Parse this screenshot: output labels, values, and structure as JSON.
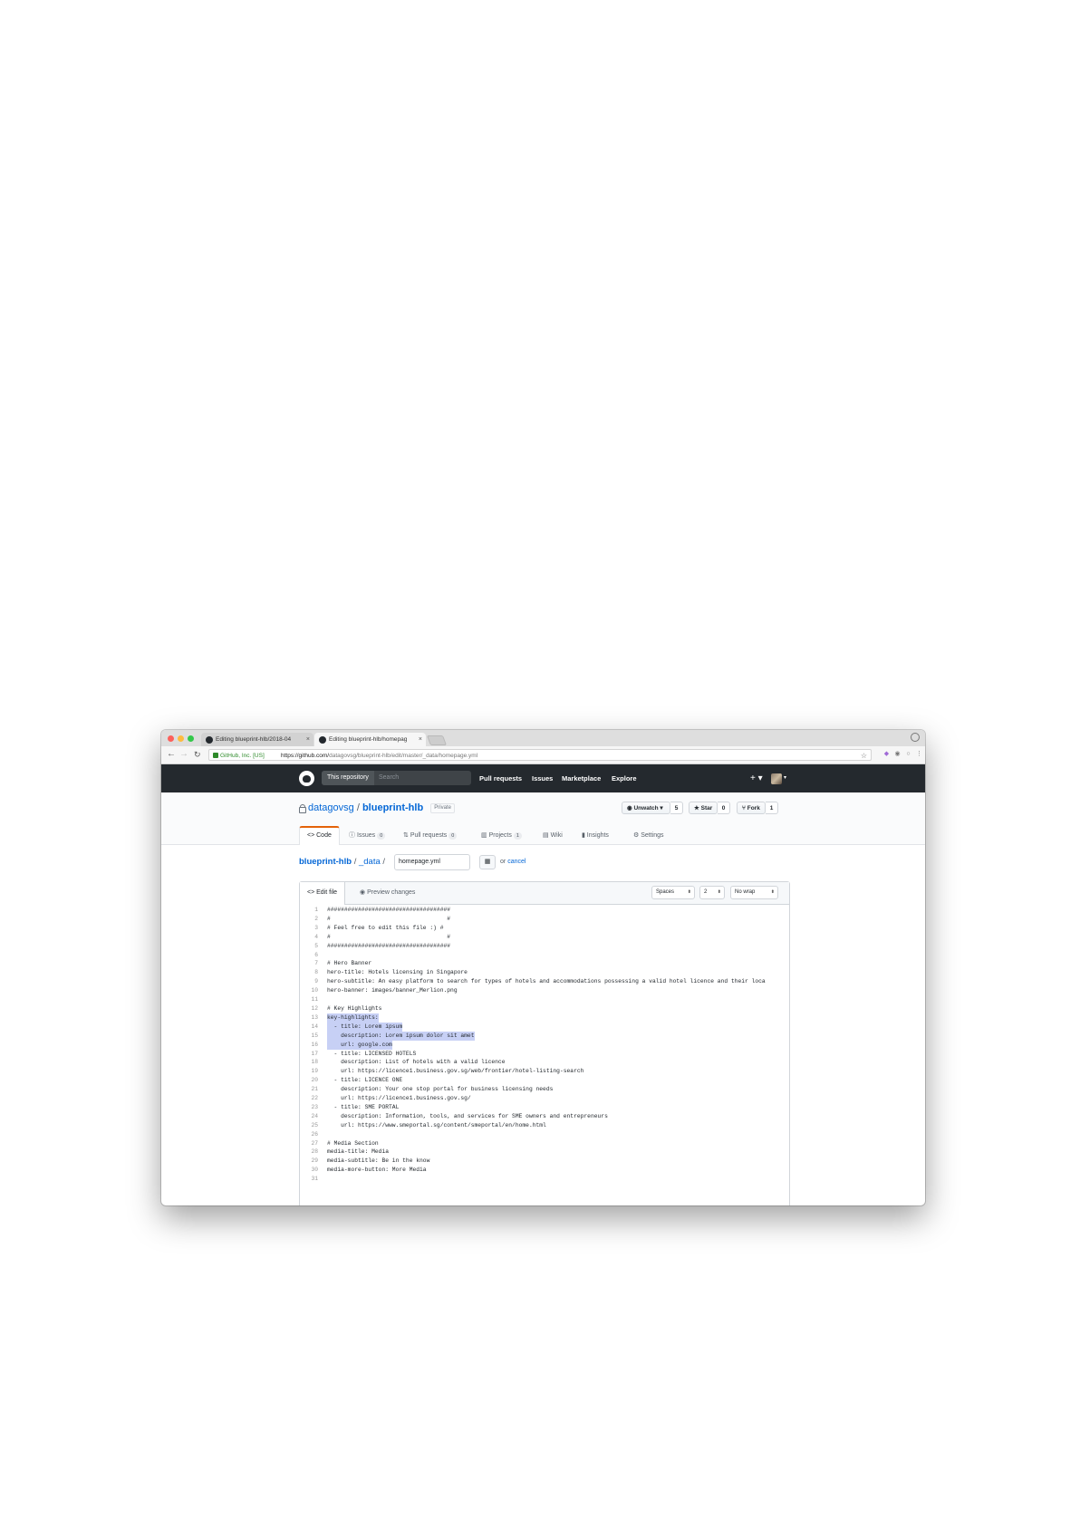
{
  "browser": {
    "tabs": [
      {
        "label": "Editing blueprint-hlb/2018-04"
      },
      {
        "label": "Editing blueprint-hlb/homepag"
      }
    ],
    "address": {
      "secure_label": "GitHub, Inc. [US]",
      "url_host": "https://github.com/",
      "url_path": "datagovsg/blueprint-hlb/edit/master/_data/homepage.yml"
    }
  },
  "github_header": {
    "search_scope": "This repository",
    "search_placeholder": "Search",
    "nav": [
      "Pull requests",
      "Issues",
      "Marketplace",
      "Explore"
    ],
    "plus": "+ ▾"
  },
  "repo": {
    "owner": "datagovsg",
    "separator": "/",
    "name": "blueprint-hlb",
    "visibility": "Private",
    "actions": [
      {
        "label": "Unwatch ▾",
        "count": "5"
      },
      {
        "label": "Star",
        "count": "0"
      },
      {
        "label": "Fork",
        "count": "1"
      }
    ],
    "tabs": [
      {
        "label": "Code",
        "count": ""
      },
      {
        "label": "Issues",
        "count": "0"
      },
      {
        "label": "Pull requests",
        "count": "0"
      },
      {
        "label": "Projects",
        "count": "1"
      },
      {
        "label": "Wiki",
        "count": ""
      },
      {
        "label": "Insights",
        "count": ""
      },
      {
        "label": "Settings",
        "count": ""
      }
    ]
  },
  "breadcrumb": {
    "repo": "blueprint-hlb",
    "dir": "_data",
    "sep": "/",
    "filename": "homepage.yml",
    "or": "or",
    "cancel": "cancel"
  },
  "editor": {
    "tabs": [
      "Edit file",
      "Preview changes"
    ],
    "indent_mode": "Spaces",
    "indent_size": "2",
    "wrap_mode": "No wrap",
    "lines": [
      "####################################",
      "#                                  #",
      "# Feel free to edit this file :) #",
      "#                                  #",
      "####################################",
      "",
      "# Hero Banner",
      "hero-title: Hotels licensing in Singapore",
      "hero-subtitle: An easy platform to search for types of hotels and accommodations possessing a valid hotel licence and their loca",
      "hero-banner: images/banner_Merlion.png",
      "",
      "# Key Highlights",
      "key-highlights:",
      "  - title: Lorem ipsum",
      "    description: Lorem ipsum dolor sit amet",
      "    url: google.com",
      "  - title: LICENSED HOTELS",
      "    description: List of hotels with a valid licence",
      "    url: https://licence1.business.gov.sg/web/frontier/hotel-listing-search",
      "  - title: LICENCE ONE",
      "    description: Your one stop portal for business licensing needs",
      "    url: https://licence1.business.gov.sg/",
      "  - title: SME PORTAL",
      "    description: Information, tools, and services for SME owners and entrepreneurs",
      "    url: https://www.smeportal.sg/content/smeportal/en/home.html",
      "",
      "# Media Section",
      "media-title: Media",
      "media-subtitle: Be in the know",
      "media-more-button: More Media",
      ""
    ],
    "line_numbers": [
      "1",
      "2",
      "3",
      "4",
      "5",
      "6",
      "7",
      "8",
      "9",
      "10",
      "11",
      "12",
      "13",
      "14",
      "15",
      "16",
      "17",
      "18",
      "19",
      "20",
      "21",
      "22",
      "23",
      "24",
      "25",
      "26",
      "27",
      "28",
      "29",
      "30",
      "31"
    ],
    "highlighted_lines": [
      13,
      14,
      15,
      16
    ]
  }
}
